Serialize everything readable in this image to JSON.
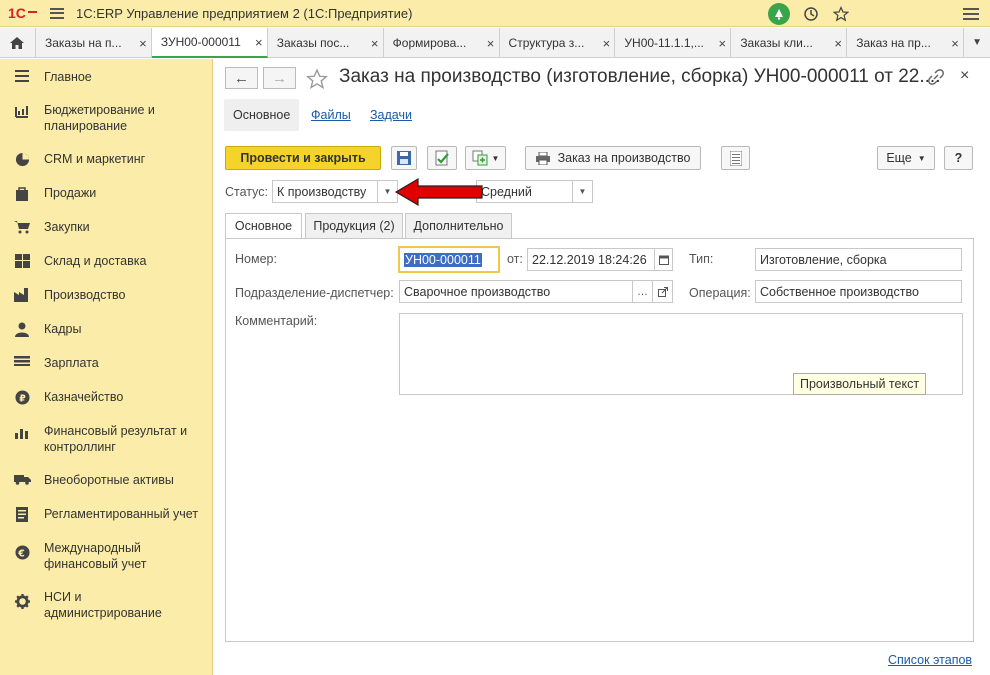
{
  "app": {
    "logo_text": "1С",
    "title": "1С:ERP Управление предприятием 2  (1С:Предприятие)"
  },
  "tabs": [
    {
      "label": "Заказы на п...",
      "active": false
    },
    {
      "label": "ЗУН00-000011",
      "active": true
    },
    {
      "label": "Заказы пос...",
      "active": false
    },
    {
      "label": "Формирова...",
      "active": false
    },
    {
      "label": "Структура з...",
      "active": false
    },
    {
      "label": "УН00-11.1.1,...",
      "active": false
    },
    {
      "label": "Заказы кли...",
      "active": false
    },
    {
      "label": "Заказ на пр...",
      "active": false
    }
  ],
  "sidebar": {
    "items": [
      {
        "label": "Главное",
        "icon": "menu-icon"
      },
      {
        "label": "Бюджетирование и планирование",
        "icon": "budget-icon"
      },
      {
        "label": "CRM и маркетинг",
        "icon": "pie-chart-icon"
      },
      {
        "label": "Продажи",
        "icon": "shopping-bag-icon"
      },
      {
        "label": "Закупки",
        "icon": "cart-icon"
      },
      {
        "label": "Склад и доставка",
        "icon": "warehouse-icon"
      },
      {
        "label": "Производство",
        "icon": "factory-icon"
      },
      {
        "label": "Кадры",
        "icon": "person-icon"
      },
      {
        "label": "Зарплата",
        "icon": "salary-icon"
      },
      {
        "label": "Казначейство",
        "icon": "ruble-icon"
      },
      {
        "label": "Финансовый результат и контроллинг",
        "icon": "bar-chart-icon"
      },
      {
        "label": "Внеоборотные активы",
        "icon": "truck-icon"
      },
      {
        "label": "Регламентированный учет",
        "icon": "document-icon"
      },
      {
        "label": "Международный финансовый учет",
        "icon": "euro-icon"
      },
      {
        "label": "НСИ и администрирование",
        "icon": "gear-icon"
      }
    ]
  },
  "document": {
    "title": "Заказ на производство (изготовление, сборка) УН00-000011 от 22....",
    "subtabs": [
      "Основное",
      "Файлы",
      "Задачи"
    ]
  },
  "toolbar": {
    "post_and_close": "Провести и закрыть",
    "production_order": "Заказ на производство",
    "more": "Еще",
    "help": "?"
  },
  "status": {
    "label": "Статус:",
    "value": "К производству",
    "priority": "Средний"
  },
  "form_tabs": [
    "Основное",
    "Продукция (2)",
    "Дополнительно"
  ],
  "fields": {
    "number_label": "Номер:",
    "number_value": "УН00-000011",
    "date_label": "от:",
    "date_value": "22.12.2019 18:24:26",
    "type_label": "Тип:",
    "type_value": "Изготовление, сборка",
    "dept_label": "Подразделение-диспетчер:",
    "dept_value": "Сварочное производство",
    "operation_label": "Операция:",
    "operation_value": "Собственное производство",
    "comment_label": "Комментарий:",
    "comment_placeholder": "Произвольный текст"
  },
  "footer": {
    "stages_link": "Список этапов"
  },
  "colors": {
    "sidebar_bg": "#fbeda9",
    "primary_button": "#f6d32a",
    "accent_green": "#3aa44a",
    "link_blue": "#1a5aa8",
    "arrow_red": "#e00000"
  }
}
